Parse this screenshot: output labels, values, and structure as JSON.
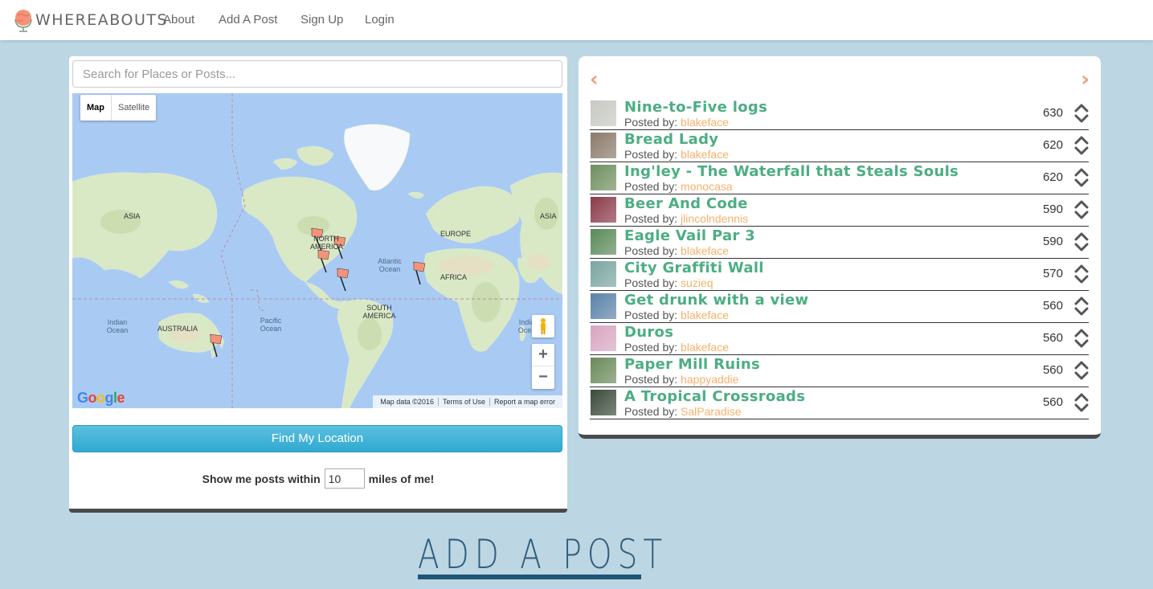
{
  "nav": {
    "brand": "WHEREABOUTS",
    "links": [
      "About",
      "Add A Post",
      "Sign Up",
      "Login"
    ]
  },
  "search": {
    "placeholder": "Search for Places or Posts..."
  },
  "map": {
    "type_map": "Map",
    "type_satellite": "Satellite",
    "labels": {
      "asia_left": "ASIA",
      "north_america": "NORTH AMERICA",
      "europe": "EUROPE",
      "africa": "AFRICA",
      "south_america": "SOUTH AMERICA",
      "australia": "AUSTRALIA",
      "asia_right": "ASIA",
      "atlantic": "Atlantic Ocean",
      "pacific": "Pacific Ocean",
      "indian_left": "Indian Ocean",
      "indian_right": "Indian Ocean"
    },
    "zoom_in": "+",
    "zoom_out": "−",
    "google": "Google",
    "attribution": [
      "Map data ©2016",
      "Terms of Use",
      "Report a map error"
    ]
  },
  "find_button": "Find My Location",
  "radius": {
    "prefix": "Show me posts within",
    "value": "10",
    "suffix": "miles of me!"
  },
  "carousel": {
    "prev": "‹",
    "next": "›"
  },
  "posts": [
    {
      "title": "Nine-to-Five logs",
      "posted_by": "Posted by:",
      "author": "blakeface",
      "score": "630",
      "thumb_color": "#c7c9c2"
    },
    {
      "title": "Bread Lady",
      "posted_by": "Posted by:",
      "author": "blakeface",
      "score": "620",
      "thumb_color": "#8a7a6a"
    },
    {
      "title": "Ing'ley - The Waterfall that Steals Souls",
      "posted_by": "Posted by:",
      "author": "monocasa",
      "score": "620",
      "thumb_color": "#6f8f5e"
    },
    {
      "title": "Beer And Code",
      "posted_by": "Posted by:",
      "author": "jlincolndennis",
      "score": "590",
      "thumb_color": "#8a3a4a"
    },
    {
      "title": "Eagle Vail Par 3",
      "posted_by": "Posted by:",
      "author": "blakeface",
      "score": "590",
      "thumb_color": "#5a8a5a"
    },
    {
      "title": "City Graffiti Wall",
      "posted_by": "Posted by:",
      "author": "suzieq",
      "score": "570",
      "thumb_color": "#7aa5a0"
    },
    {
      "title": "Get drunk with a view",
      "posted_by": "Posted by:",
      "author": "blakeface",
      "score": "560",
      "thumb_color": "#5b82a8"
    },
    {
      "title": "Duros",
      "posted_by": "Posted by:",
      "author": "blakeface",
      "score": "560",
      "thumb_color": "#d8a6c0"
    },
    {
      "title": "Paper Mill Ruins",
      "posted_by": "Posted by:",
      "author": "happyaddie",
      "score": "560",
      "thumb_color": "#6a8a5a"
    },
    {
      "title": "A Tropical Crossroads",
      "posted_by": "Posted by:",
      "author": "SalParadise",
      "score": "560",
      "thumb_color": "#3a4a3a"
    }
  ],
  "add_post_heading": "ADD A POST",
  "colors": {
    "background": "#bcd6e3",
    "post_title": "#4cae82",
    "author": "#f7b06a",
    "arrow": "#f59a7a",
    "button": "#31a9d1",
    "heading": "#2f5d7c",
    "logo": "#f4937a"
  }
}
